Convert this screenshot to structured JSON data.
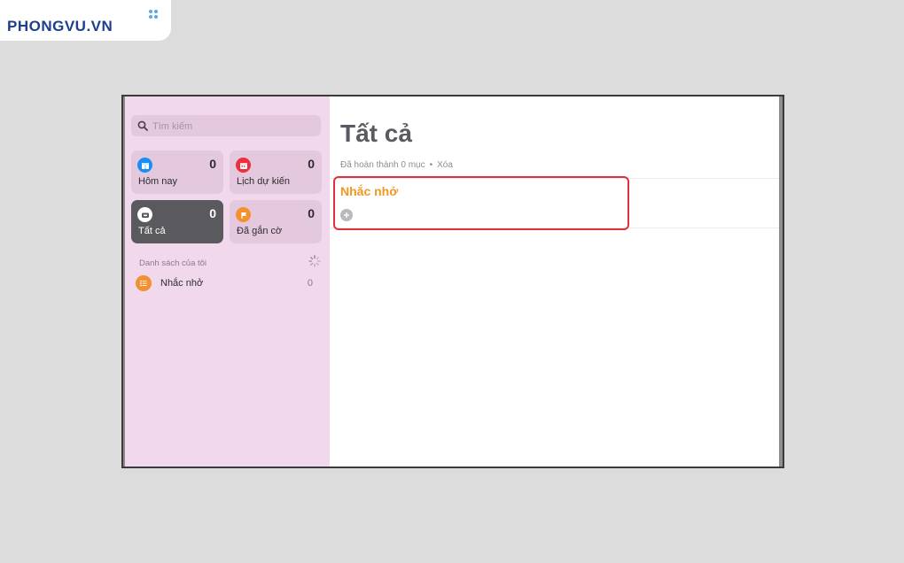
{
  "watermark": {
    "brand": "PHONGVU.VN"
  },
  "search": {
    "placeholder": "Tìm kiếm"
  },
  "smart_lists": [
    {
      "label": "Hôm nay",
      "count": "0",
      "color": "#1a8ef7",
      "icon": "calendar-today-icon"
    },
    {
      "label": "Lịch dự kiến",
      "count": "0",
      "color": "#ec2f3c",
      "icon": "calendar-scheduled-icon"
    },
    {
      "label": "Tất cả",
      "count": "0",
      "color": "#ffffff",
      "icon": "inbox-tray-icon",
      "selected": true
    },
    {
      "label": "Đã gắn cờ",
      "count": "0",
      "color": "#f3912e",
      "icon": "flag-icon"
    }
  ],
  "my_lists": {
    "title": "Danh sách của tôi",
    "items": [
      {
        "label": "Nhắc nhở",
        "count": "0",
        "color": "#f3912e"
      }
    ]
  },
  "main": {
    "title": "Tất cả",
    "completed_text": "Đã hoàn thành 0 mục",
    "separator": "•",
    "clear_label": "Xóa",
    "group_title": "Nhắc nhở",
    "group_color": "#f5961f",
    "highlight_color": "#e2303c"
  }
}
